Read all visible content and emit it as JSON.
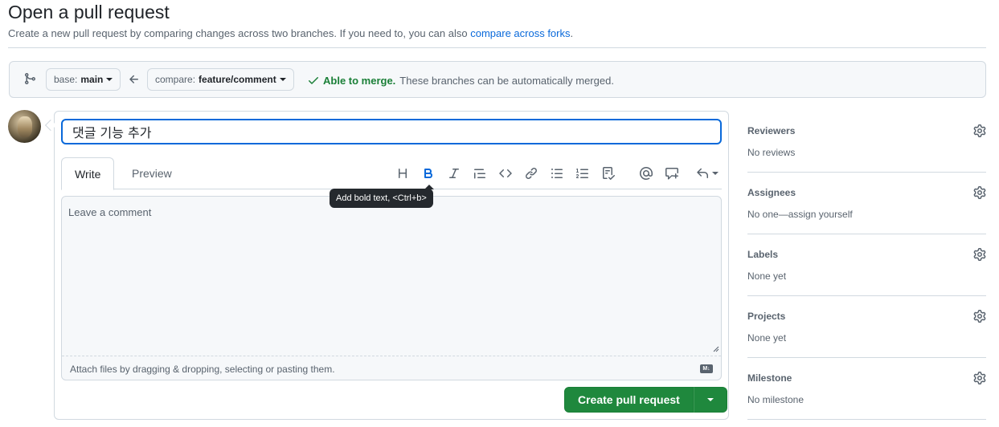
{
  "header": {
    "title": "Open a pull request",
    "subtitle": "Create a new pull request by comparing changes across two branches. If you need to, you can also",
    "subtitle_link": "compare across forks",
    "subtitle_end": "."
  },
  "range": {
    "base_prefix": "base:",
    "base_branch": "main",
    "compare_prefix": "compare:",
    "compare_branch": "feature/comment",
    "merge_status": "Able to merge.",
    "merge_message": "These branches can be automatically merged."
  },
  "form": {
    "title_value": "댓글 기능 추가",
    "tabs": [
      "Write",
      "Preview"
    ],
    "toolbar": [
      "heading-icon",
      "bold-icon",
      "italic-icon",
      "quote-icon",
      "code-icon",
      "link-icon",
      "unordered-list-icon",
      "ordered-list-icon",
      "task-list-icon",
      "mention-icon",
      "reference-icon",
      "reply-icon"
    ],
    "tooltip": "Add bold text, <Ctrl+b>",
    "comment_placeholder": "Leave a comment",
    "attach_text": "Attach files by dragging & dropping, selecting or pasting them.",
    "markdown_badge": "M↓",
    "submit_label": "Create pull request"
  },
  "sidebar": [
    {
      "heading": "Reviewers",
      "value": "No reviews"
    },
    {
      "heading": "Assignees",
      "value": "No one—assign yourself"
    },
    {
      "heading": "Labels",
      "value": "None yet"
    },
    {
      "heading": "Projects",
      "value": "None yet"
    },
    {
      "heading": "Milestone",
      "value": "No milestone"
    }
  ],
  "colors": {
    "accent": "#0969da",
    "success": "#1f883d",
    "border": "#d1d9e0",
    "muted": "#59636e",
    "tooltip_bg": "#25292e"
  }
}
